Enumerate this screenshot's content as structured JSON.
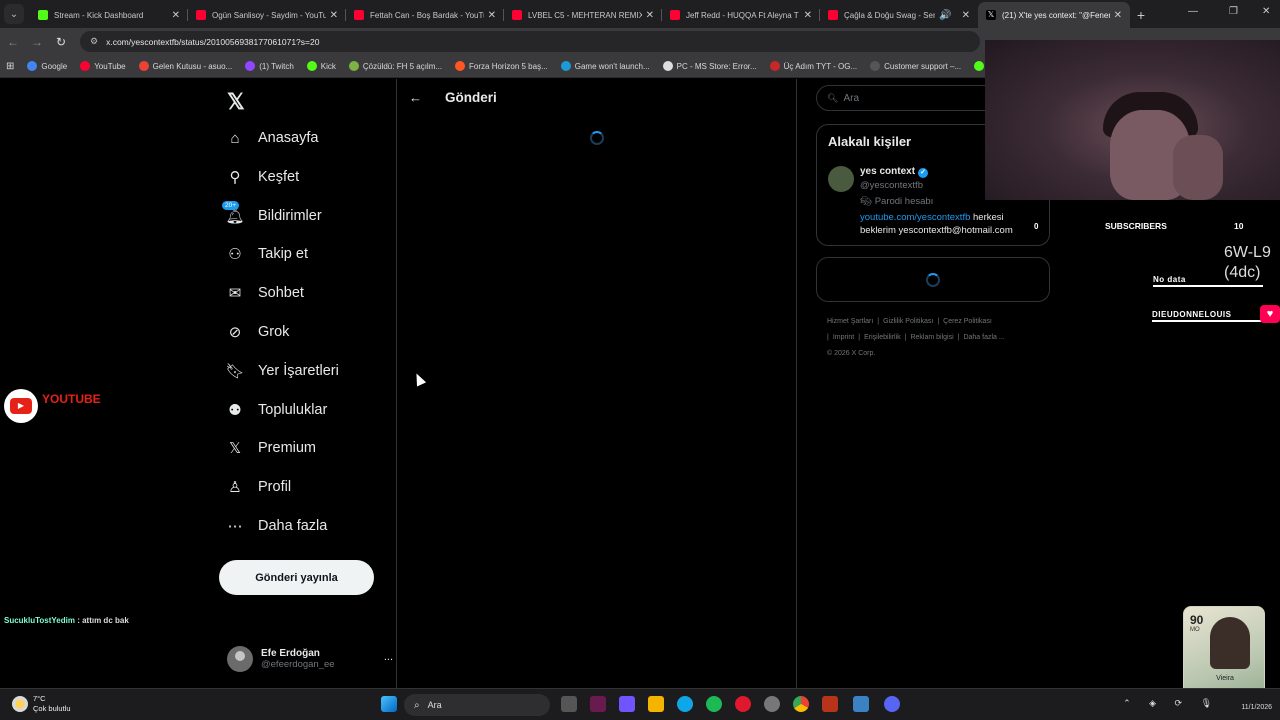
{
  "browser": {
    "tabs": [
      {
        "title": "Stream - Kick Dashboard",
        "icon": "kick-icon",
        "color": "#53fc18"
      },
      {
        "title": "Ogün Sanlisoy - Saydim - YouTube",
        "icon": "youtube-icon",
        "color": "#ff0033"
      },
      {
        "title": "Fettah Can - Boş Bardak - YouTube",
        "icon": "youtube-icon",
        "color": "#ff0033"
      },
      {
        "title": "LVBEL C5 - MEHTERAN REMIX",
        "icon": "youtube-icon",
        "color": "#ff0033"
      },
      {
        "title": "Jeff Redd - HUQQA Ft Aleyna T",
        "icon": "youtube-icon",
        "color": "#ff0033"
      },
      {
        "title": "Çağla & Doğu Swag - Seni",
        "icon": "youtube-icon",
        "color": "#ff0033"
      }
    ],
    "active_tab": {
      "title": "(21) X'te yes context: \"@Fenerb",
      "icon": "x-icon"
    },
    "url": "x.com/yescontextfb/status/2010056938177061071?s=20",
    "bookmarks": [
      {
        "label": "Google",
        "color": "#4285f4"
      },
      {
        "label": "YouTube",
        "color": "#ff0033"
      },
      {
        "label": "Gelen Kutusu - asuo...",
        "color": "#ea4335"
      },
      {
        "label": "(1) Twitch",
        "color": "#9146ff"
      },
      {
        "label": "Kick",
        "color": "#53fc18"
      },
      {
        "label": "Çözüldü: FH 5 açılm...",
        "color": "#7cb342"
      },
      {
        "label": "Forza Horizon 5 baş...",
        "color": "#ff5722"
      },
      {
        "label": "Game won't launch...",
        "color": "#1b9ad6"
      },
      {
        "label": "PC - MS Store: Error...",
        "color": "#dddddd"
      },
      {
        "label": "Üç Adım TYT - OG...",
        "color": "#c62828"
      },
      {
        "label": "Customer support –...",
        "color": "#555555"
      },
      {
        "label": "Ki",
        "color": "#53fc18"
      }
    ]
  },
  "sidebar": {
    "items": [
      {
        "label": "Anasayfa",
        "icon": "home-icon"
      },
      {
        "label": "Keşfet",
        "icon": "search-icon"
      },
      {
        "label": "Bildirimler",
        "icon": "bell-icon",
        "badge": "20+"
      },
      {
        "label": "Takip et",
        "icon": "follow-icon"
      },
      {
        "label": "Sohbet",
        "icon": "mail-icon"
      },
      {
        "label": "Grok",
        "icon": "grok-icon"
      },
      {
        "label": "Yer İşaretleri",
        "icon": "bookmark-icon"
      },
      {
        "label": "Topluluklar",
        "icon": "communities-icon"
      },
      {
        "label": "Premium",
        "icon": "x-icon"
      },
      {
        "label": "Profil",
        "icon": "profile-icon"
      },
      {
        "label": "Daha fazla",
        "icon": "more-icon"
      }
    ],
    "post_button": "Gönderi yayınla",
    "account": {
      "name": "Efe Erdoğan",
      "handle": "@efeerdogan_ee",
      "more": "..."
    }
  },
  "main": {
    "title": "Gönderi"
  },
  "right": {
    "search_placeholder": "Ara",
    "related_title": "Alakalı kişiler",
    "person": {
      "name": "yes context",
      "handle": "@yescontextfb",
      "parody": "Parodi hesabı",
      "bio_link": "youtube.com/yescontextfb",
      "bio_text": " herkesi beklerim yescontextfb@hotmail.com"
    },
    "footer": [
      "Hizmet Şartları",
      "|",
      "Gizlilik Politikası",
      "|",
      "Çerez Politikası",
      "|",
      "Imprint",
      "|",
      "Erişilebilirlik",
      "|",
      "Reklam bilgisi",
      "|",
      "Daha fazla ...",
      "© 2026 X Corp."
    ]
  },
  "overlays": {
    "subscribers_label": "SUBSCRIBERS",
    "subscribers_value": "10",
    "goal_line1": "6W-L9",
    "goal_line2": "(4dc)",
    "no_data": "No data",
    "zero": "0",
    "donor": "DIEUDONNELOUIS",
    "youtube_label": "YOUTUBE",
    "chat_user": "SucukluTostYedim",
    "chat_msg": " : attım dc bak",
    "card_rating": "90",
    "card_pos": "MO",
    "card_name": "Vieira"
  },
  "taskbar": {
    "temp": "7°C",
    "weather": "Çok bulutlu",
    "search": "Ara",
    "date": "11/1/2026"
  }
}
